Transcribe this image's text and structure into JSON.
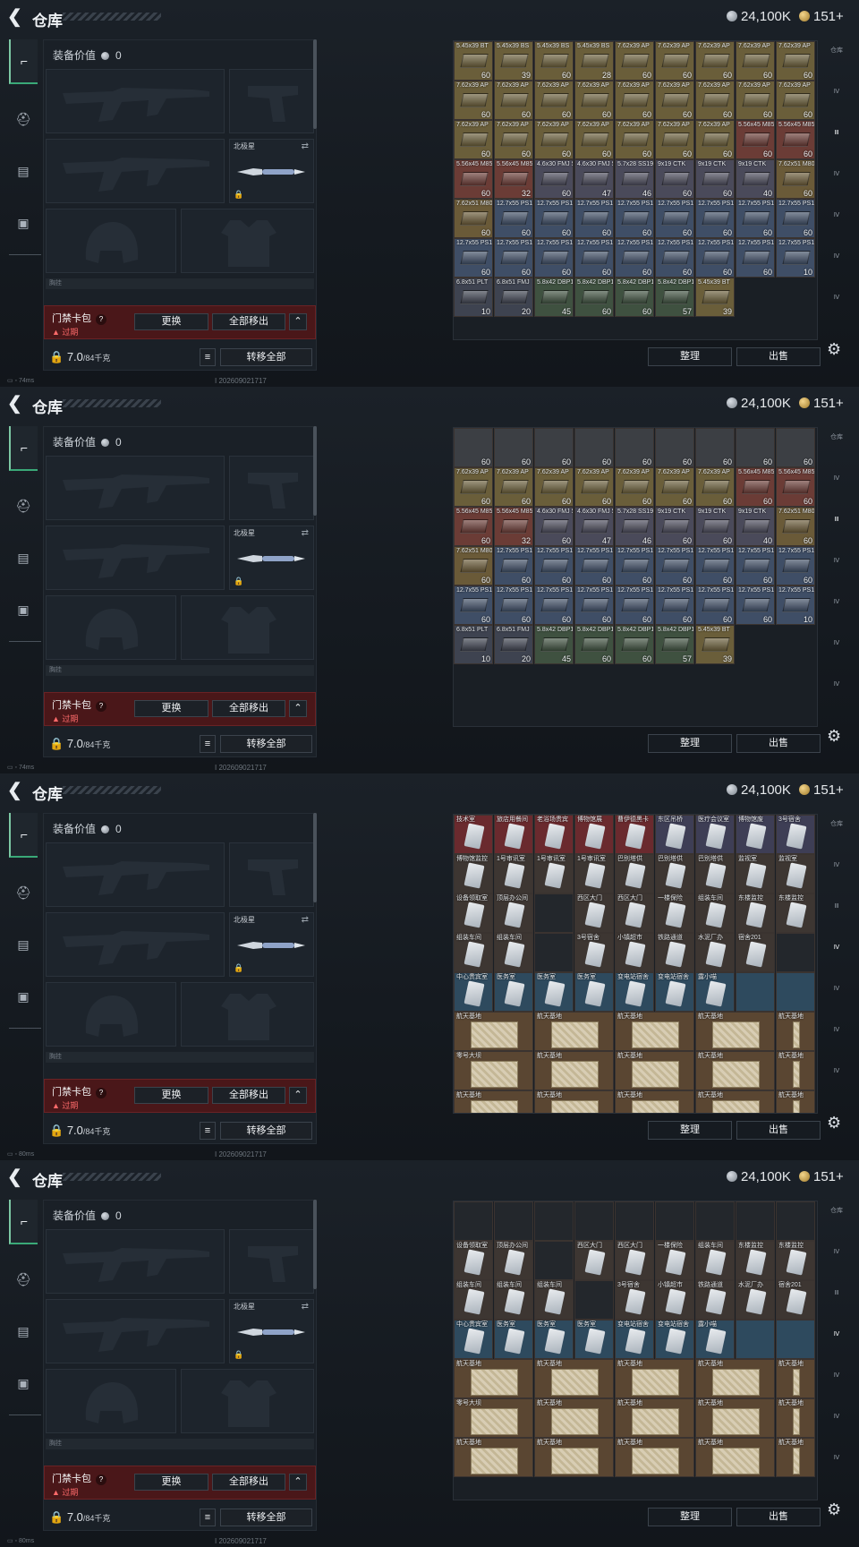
{
  "header": {
    "title": "仓库",
    "silver_value": "24,100K",
    "gold_value": "151+"
  },
  "sidebar": {
    "tabs": [
      "weapon-icon",
      "helmet-icon",
      "clipboard-icon",
      "briefcase-icon"
    ]
  },
  "equipment": {
    "value_label": "装备价值",
    "value": "0",
    "melee_label": "北极星",
    "keycard_name": "门禁卡包",
    "keycard_status": "过期",
    "replace_label": "更换",
    "remove_all_label": "全部移出",
    "weight": "7.0",
    "weight_cap": "/84千克",
    "transfer_all_label": "转移全部",
    "pocket_label": "胸挂"
  },
  "grid_buttons": {
    "sort_label": "整理",
    "sell_label": "出售"
  },
  "right_tabs": [
    "仓库",
    "Ⅳ",
    "Ⅲ",
    "Ⅳ",
    "Ⅳ",
    "Ⅳ",
    "Ⅳ"
  ],
  "frames": [
    {
      "ping": "74ms",
      "uid": "I 202609021717",
      "items": [
        [
          "5.45x39 BT",
          "60"
        ],
        [
          "5.45x39 BS",
          "39"
        ],
        [
          "5.45x39 BS",
          "60"
        ],
        [
          "5.45x39 BS",
          "28"
        ],
        [
          "7.62x39 AP",
          "60"
        ],
        [
          "7.62x39 AP",
          "60"
        ],
        [
          "7.62x39 AP",
          "60"
        ],
        [
          "7.62x39 AP",
          "60"
        ],
        [
          "7.62x39 AP",
          "60"
        ],
        [
          "7.62x39 AP",
          "60"
        ],
        [
          "7.62x39 AP",
          "60"
        ],
        [
          "7.62x39 AP",
          "60"
        ],
        [
          "7.62x39 AP",
          "60"
        ],
        [
          "7.62x39 AP",
          "60"
        ],
        [
          "7.62x39 AP",
          "60"
        ],
        [
          "7.62x39 AP",
          "60"
        ],
        [
          "7.62x39 AP",
          "60"
        ],
        [
          "7.62x39 AP",
          "60"
        ],
        [
          "7.62x39 AP",
          "60"
        ],
        [
          "7.62x39 AP",
          "60"
        ],
        [
          "7.62x39 AP",
          "60"
        ],
        [
          "7.62x39 AP",
          "60"
        ],
        [
          "7.62x39 AP",
          "60"
        ],
        [
          "7.62x39 AP",
          "60"
        ],
        [
          "7.62x39 AP",
          "60"
        ],
        [
          "5.56x45 M855",
          "60"
        ],
        [
          "5.56x45 M855",
          "60"
        ],
        [
          "5.56x45 M855",
          "60"
        ],
        [
          "5.56x45 M855",
          "32"
        ],
        [
          "4.6x30 FMJ SX",
          "60"
        ],
        [
          "4.6x30 FMJ SX",
          "47"
        ],
        [
          "5.7x28 SS190",
          "46"
        ],
        [
          "9x19 CTK",
          "60"
        ],
        [
          "9x19 CTK",
          "60"
        ],
        [
          "9x19 CTK",
          "40"
        ],
        [
          "7.62x51 M80",
          "60"
        ],
        [
          "7.62x51 M80",
          "60"
        ],
        [
          "12.7x55 PS12",
          "60"
        ],
        [
          "12.7x55 PS12",
          "60"
        ],
        [
          "12.7x55 PS12",
          "60"
        ],
        [
          "12.7x55 PS12",
          "60"
        ],
        [
          "12.7x55 PS12",
          "60"
        ],
        [
          "12.7x55 PS12",
          "60"
        ],
        [
          "12.7x55 PS12",
          "60"
        ],
        [
          "12.7x55 PS12",
          "60"
        ],
        [
          "12.7x55 PS12",
          "60"
        ],
        [
          "12.7x55 PS12",
          "60"
        ],
        [
          "12.7x55 PS12",
          "60"
        ],
        [
          "12.7x55 PS12",
          "60"
        ],
        [
          "12.7x55 PS12",
          "60"
        ],
        [
          "12.7x55 PS12",
          "60"
        ],
        [
          "12.7x55 PS12",
          "60"
        ],
        [
          "12.7x55 PS12",
          "60"
        ],
        [
          "12.7x55 PS12",
          "10"
        ],
        [
          "6.8x51 PLT",
          "10"
        ],
        [
          "6.8x51 FMJ",
          "20"
        ],
        [
          "5.8x42 DBP10+P",
          "45"
        ],
        [
          "5.8x42 DBP10",
          "60"
        ],
        [
          "5.8x42 DBP10",
          "60"
        ],
        [
          "5.8x42 DBP10",
          "57"
        ],
        [
          "5.45x39 BT",
          "39"
        ]
      ]
    },
    {
      "ping": "74ms",
      "uid": "I 202609021717",
      "items": [
        [
          "",
          "60"
        ],
        [
          "",
          "60"
        ],
        [
          "",
          "60"
        ],
        [
          "",
          "60"
        ],
        [
          "",
          "60"
        ],
        [
          "",
          "60"
        ],
        [
          "",
          "60"
        ],
        [
          "",
          "60"
        ],
        [
          "",
          "60"
        ],
        [
          "7.62x39 AP",
          "60"
        ],
        [
          "7.62x39 AP",
          "60"
        ],
        [
          "7.62x39 AP",
          "60"
        ],
        [
          "7.62x39 AP",
          "60"
        ],
        [
          "7.62x39 AP",
          "60"
        ],
        [
          "7.62x39 AP",
          "60"
        ],
        [
          "7.62x39 AP",
          "60"
        ],
        [
          "5.56x45 M855",
          "60"
        ],
        [
          "5.56x45 M855",
          "60"
        ],
        [
          "5.56x45 M855",
          "60"
        ],
        [
          "5.56x45 M855",
          "32"
        ],
        [
          "4.6x30 FMJ SX",
          "60"
        ],
        [
          "4.6x30 FMJ SX",
          "47"
        ],
        [
          "5.7x28 SS190",
          "46"
        ],
        [
          "9x19 CTK",
          "60"
        ],
        [
          "9x19 CTK",
          "60"
        ],
        [
          "9x19 CTK",
          "40"
        ],
        [
          "7.62x51 M80",
          "60"
        ],
        [
          "7.62x51 M80",
          "60"
        ],
        [
          "12.7x55 PS12",
          "60"
        ],
        [
          "12.7x55 PS12",
          "60"
        ],
        [
          "12.7x55 PS12",
          "60"
        ],
        [
          "12.7x55 PS12",
          "60"
        ],
        [
          "12.7x55 PS12",
          "60"
        ],
        [
          "12.7x55 PS12",
          "60"
        ],
        [
          "12.7x55 PS12",
          "60"
        ],
        [
          "12.7x55 PS12",
          "60"
        ],
        [
          "12.7x55 PS12",
          "60"
        ],
        [
          "12.7x55 PS12",
          "60"
        ],
        [
          "12.7x55 PS12",
          "60"
        ],
        [
          "12.7x55 PS12",
          "60"
        ],
        [
          "12.7x55 PS12",
          "60"
        ],
        [
          "12.7x55 PS12",
          "60"
        ],
        [
          "12.7x55 PS12",
          "60"
        ],
        [
          "12.7x55 PS12",
          "60"
        ],
        [
          "12.7x55 PS12",
          "10"
        ],
        [
          "6.8x51 PLT",
          "10"
        ],
        [
          "6.8x51 FMJ",
          "20"
        ],
        [
          "5.8x42 DBP10+P",
          "45"
        ],
        [
          "5.8x42 DBP10",
          "60"
        ],
        [
          "5.8x42 DBP10",
          "60"
        ],
        [
          "5.8x42 DBP10",
          "57"
        ],
        [
          "5.45x39 BT",
          "39"
        ]
      ]
    },
    {
      "ping": "80ms",
      "uid": "I 202609021717",
      "items": [
        [
          "技术室",
          ""
        ],
        [
          "旅店用餐间",
          ""
        ],
        [
          "老浴场贵宾",
          ""
        ],
        [
          "博物馆展",
          ""
        ],
        [
          "曹伊德黑卡",
          ""
        ],
        [
          "东区吊桥",
          ""
        ],
        [
          "医疗会议室",
          ""
        ],
        [
          "博物馆废",
          ""
        ],
        [
          "3号宿舍",
          ""
        ],
        [
          "博物馆监控",
          ""
        ],
        [
          "1号审讯室",
          ""
        ],
        [
          "1号审讯室",
          ""
        ],
        [
          "1号审讯室",
          ""
        ],
        [
          "巴别塔供",
          ""
        ],
        [
          "巴别塔供",
          ""
        ],
        [
          "巴别塔供",
          ""
        ],
        [
          "监视室",
          ""
        ],
        [
          "监视室",
          ""
        ],
        [
          "设备领取室",
          ""
        ],
        [
          "顶层办公间",
          ""
        ],
        [
          "",
          ""
        ],
        [
          "西区大门",
          ""
        ],
        [
          "西区大门",
          ""
        ],
        [
          "一楼保险",
          ""
        ],
        [
          "组装车间",
          ""
        ],
        [
          "东楼监控",
          ""
        ],
        [
          "东楼监控",
          ""
        ],
        [
          "组装车间",
          ""
        ],
        [
          "组装车间",
          ""
        ],
        [
          "",
          ""
        ],
        [
          "3号宿舍",
          ""
        ],
        [
          "小镇超市",
          ""
        ],
        [
          "铁路通道",
          ""
        ],
        [
          "水泥厂办",
          ""
        ],
        [
          "宿舍201",
          ""
        ],
        [
          "",
          ""
        ],
        [
          "中心贵宾室",
          ""
        ],
        [
          "医务室",
          ""
        ],
        [
          "医务室",
          ""
        ],
        [
          "医务室",
          ""
        ],
        [
          "变电站宿舍",
          ""
        ],
        [
          "变电站宿舍",
          ""
        ],
        [
          "露小喵",
          ""
        ],
        [
          "",
          ""
        ],
        [
          "",
          ""
        ],
        [
          "航天基地",
          ""
        ],
        [
          "航天基地",
          ""
        ],
        [
          "航天基地",
          ""
        ],
        [
          "航天基地",
          ""
        ],
        [
          "航天基地",
          ""
        ],
        [
          "零号大坝",
          ""
        ],
        [
          "航天基地",
          ""
        ],
        [
          "航天基地",
          ""
        ],
        [
          "航天基地",
          ""
        ],
        [
          "航天基地",
          ""
        ],
        [
          "航天基地",
          ""
        ],
        [
          "航天基地",
          ""
        ],
        [
          "航天基地",
          ""
        ],
        [
          "航天基地",
          ""
        ],
        [
          "航天基地",
          ""
        ]
      ]
    },
    {
      "ping": "80ms",
      "uid": "I 202609021717",
      "items": [
        [
          "",
          ""
        ],
        [
          "",
          ""
        ],
        [
          "",
          ""
        ],
        [
          "",
          ""
        ],
        [
          "",
          ""
        ],
        [
          "",
          ""
        ],
        [
          "",
          ""
        ],
        [
          "",
          ""
        ],
        [
          "",
          ""
        ],
        [
          "设备领取室",
          ""
        ],
        [
          "顶层办公间",
          ""
        ],
        [
          "",
          ""
        ],
        [
          "西区大门",
          ""
        ],
        [
          "西区大门",
          ""
        ],
        [
          "一楼保险",
          ""
        ],
        [
          "组装车间",
          ""
        ],
        [
          "东楼监控",
          ""
        ],
        [
          "东楼监控",
          ""
        ],
        [
          "组装车间",
          ""
        ],
        [
          "组装车间",
          ""
        ],
        [
          "组装车间",
          ""
        ],
        [
          "",
          ""
        ],
        [
          "3号宿舍",
          ""
        ],
        [
          "小镇超市",
          ""
        ],
        [
          "铁路通道",
          ""
        ],
        [
          "水泥厂办",
          ""
        ],
        [
          "宿舍201",
          ""
        ],
        [
          "中心贵宾室",
          ""
        ],
        [
          "医务室",
          ""
        ],
        [
          "医务室",
          ""
        ],
        [
          "医务室",
          ""
        ],
        [
          "变电站宿舍",
          ""
        ],
        [
          "变电站宿舍",
          ""
        ],
        [
          "露小喵",
          ""
        ],
        [
          "",
          ""
        ],
        [
          "",
          ""
        ],
        [
          "航天基地",
          ""
        ],
        [
          "航天基地",
          ""
        ],
        [
          "航天基地",
          ""
        ],
        [
          "航天基地",
          ""
        ],
        [
          "航天基地",
          ""
        ],
        [
          "零号大坝",
          ""
        ],
        [
          "航天基地",
          ""
        ],
        [
          "航天基地",
          ""
        ],
        [
          "航天基地",
          ""
        ],
        [
          "航天基地",
          ""
        ],
        [
          "航天基地",
          ""
        ],
        [
          "航天基地",
          ""
        ],
        [
          "航天基地",
          ""
        ],
        [
          "航天基地",
          ""
        ],
        [
          "航天基地",
          ""
        ]
      ]
    }
  ]
}
